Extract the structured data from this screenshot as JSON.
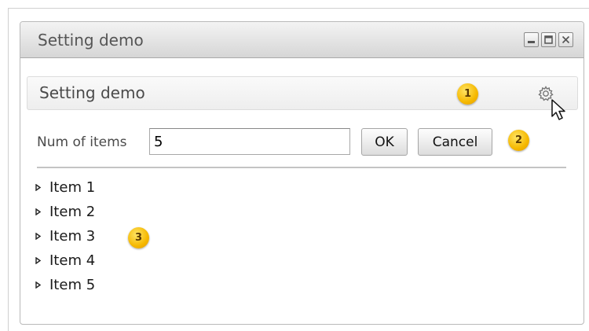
{
  "window": {
    "title": "Setting demo"
  },
  "panel": {
    "title": "Setting demo"
  },
  "form": {
    "num_label": "Num of items",
    "num_value": "5",
    "ok_label": "OK",
    "cancel_label": "Cancel"
  },
  "badges": [
    "1",
    "2",
    "3"
  ],
  "items": [
    "Item 1",
    "Item 2",
    "Item 3",
    "Item 4",
    "Item 5"
  ],
  "colors": {
    "badge": "#f5b800",
    "titlebar": "#d6d6d6",
    "divider": "#c4c4c4"
  },
  "icons": {
    "minimize": "minimize-icon",
    "maximize": "maximize-icon",
    "close": "close-icon",
    "settings": "gear-icon",
    "cursor": "cursor-icon",
    "expand": "expand-arrow-icon"
  }
}
